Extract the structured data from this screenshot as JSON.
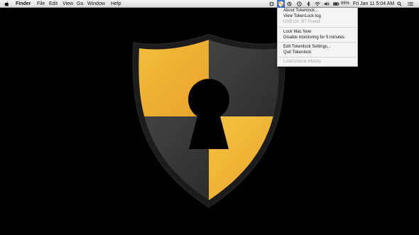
{
  "menubar": {
    "apple_icon": "apple-icon",
    "app_name": "Finder",
    "menus": [
      "File",
      "Edit",
      "View",
      "Go",
      "Window",
      "Help"
    ],
    "battery_text": "86%",
    "clock": "Fri Jan 11  5:04 AM"
  },
  "dropdown": {
    "about": "About Tokenlock...",
    "view_log": "View TokenLock log",
    "status_usb": "USB:On",
    "status_bt": "BT Found",
    "lock_now": "Lock Mac Now",
    "disable_monitoring": "Disable monitoring for 5 minutes",
    "edit_settings": "Edit Tokenlock Settings...",
    "quit": "Quit Tokenlock",
    "history": "Lock/Unlock History"
  },
  "colors": {
    "shield_yellow": "#f2b631",
    "shield_dark": "#3a3a3a",
    "shield_rim": "#1c1c1c",
    "status_icon_blue": "#3b6fd3"
  }
}
